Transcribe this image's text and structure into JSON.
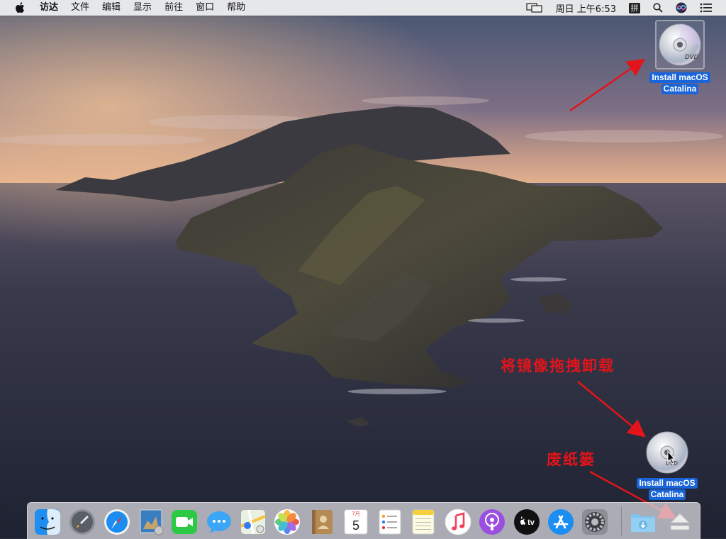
{
  "menubar": {
    "apple_icon": "apple-logo-icon",
    "items": [
      {
        "label": "访达",
        "bold": true
      },
      {
        "label": "文件"
      },
      {
        "label": "编辑"
      },
      {
        "label": "显示"
      },
      {
        "label": "前往"
      },
      {
        "label": "窗口"
      },
      {
        "label": "帮助"
      }
    ],
    "status": {
      "clock": "周日 上午6:53",
      "input_method": "拼",
      "icons": [
        "display-mirroring-icon",
        "spotlight-search-icon",
        "siri-icon",
        "notification-center-icon"
      ]
    }
  },
  "desktop": {
    "disk_icon_top": {
      "label_line1": "Install macOS",
      "label_line2": "Catalina",
      "icon": "dvd-disk-icon"
    },
    "disk_icon_dragging": {
      "label_line1": "Install macOS",
      "label_line2": "Catalina",
      "icon": "dvd-disk-icon"
    }
  },
  "annotations": {
    "drag_to_eject": "将镜像拖拽卸载",
    "trash": "废纸篓",
    "color": "#e3141a"
  },
  "dock": {
    "items": [
      {
        "name": "finder",
        "icon": "finder-icon"
      },
      {
        "name": "launchpad",
        "icon": "launchpad-rocket-icon"
      },
      {
        "name": "safari",
        "icon": "safari-compass-icon"
      },
      {
        "name": "mail-preview",
        "icon": "eagle-photo-icon"
      },
      {
        "name": "facetime",
        "icon": "facetime-icon"
      },
      {
        "name": "messages",
        "icon": "messages-icon"
      },
      {
        "name": "maps",
        "icon": "maps-icon"
      },
      {
        "name": "photos",
        "icon": "photos-icon"
      },
      {
        "name": "contacts",
        "icon": "contacts-icon"
      },
      {
        "name": "calendar",
        "icon": "calendar-icon",
        "month": "7月",
        "day": "5"
      },
      {
        "name": "reminders",
        "icon": "reminders-icon"
      },
      {
        "name": "notes",
        "icon": "notes-icon"
      },
      {
        "name": "music",
        "icon": "music-icon"
      },
      {
        "name": "podcasts",
        "icon": "podcasts-icon"
      },
      {
        "name": "apple-tv",
        "icon": "apple-tv-icon",
        "label": "tv"
      },
      {
        "name": "app-store",
        "icon": "app-store-icon"
      },
      {
        "name": "system-preferences",
        "icon": "gear-icon"
      },
      {
        "name": "downloads",
        "icon": "downloads-folder-icon"
      },
      {
        "name": "trash-eject",
        "icon": "eject-icon"
      }
    ]
  },
  "colors": {
    "selection_blue": "#1864d8",
    "menubar_bg": "#eeeef0",
    "accent_red": "#e3141a"
  }
}
